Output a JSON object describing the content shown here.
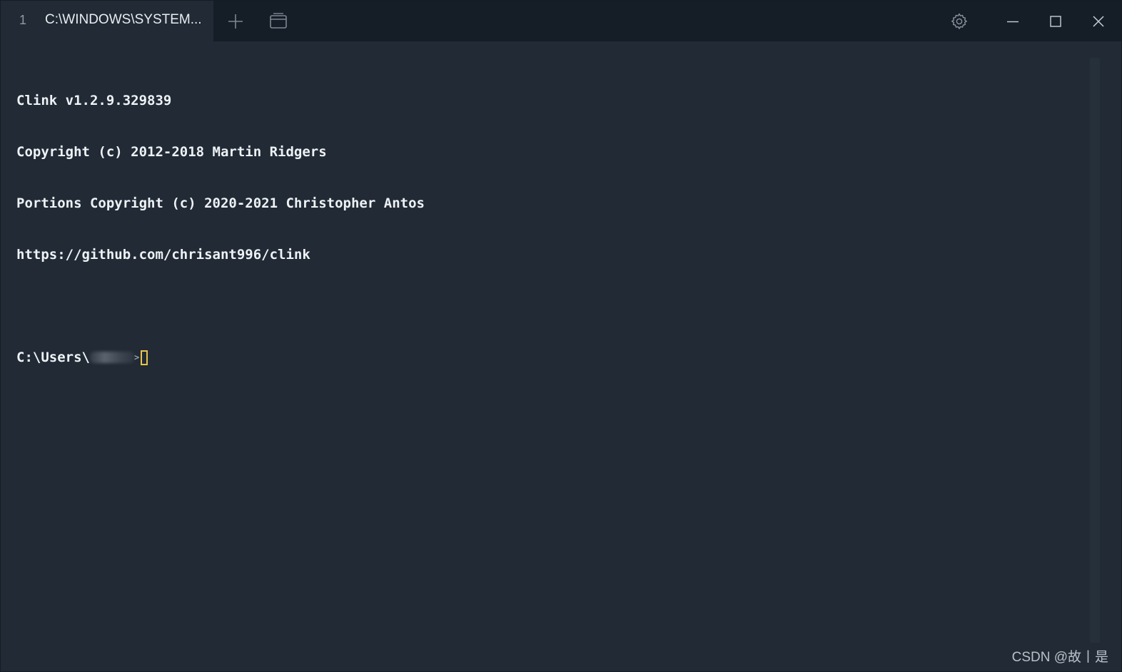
{
  "tab": {
    "index": "1",
    "title": "C:\\WINDOWS\\SYSTEM..."
  },
  "toolbar": {
    "new_tab_icon": "plus-icon",
    "new_window_icon": "window-icon",
    "settings_icon": "gear-icon",
    "minimize_icon": "minimize-icon",
    "maximize_icon": "maximize-icon",
    "close_icon": "close-icon"
  },
  "terminal": {
    "lines": [
      "Clink v1.2.9.329839",
      "Copyright (c) 2012-2018 Martin Ridgers",
      "Portions Copyright (c) 2020-2021 Christopher Antos",
      "https://github.com/chrisant996/clink"
    ],
    "prompt_prefix": "C:\\Users\\",
    "prompt_suffix": ">"
  },
  "watermark": "CSDN @故丨是",
  "colors": {
    "background": "#212a35",
    "titlebar": "#151d27",
    "text": "#eef2f5",
    "cursor": "#e8c44a"
  }
}
